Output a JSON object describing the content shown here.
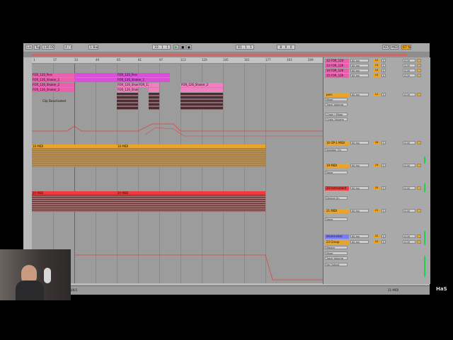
{
  "toolbar": {
    "link": "Link",
    "tap": "Tap",
    "tempo": "130.00",
    "time_sig": "4 / 4",
    "quantize": "1 Bar",
    "position": "33 . 1 . 1",
    "loop_start": "81 . 1 . 1",
    "loop_length": "8 . 0 . 0",
    "key": "KEY",
    "midi": "MIDI",
    "cpu": "67 %"
  },
  "ruler": {
    "ticks": [
      "1",
      "17",
      "33",
      "49",
      "65",
      "81",
      "97",
      "113",
      "129",
      "145",
      "161",
      "177",
      "193",
      "209"
    ]
  },
  "clips": {
    "perc": "FOR_120_Perc",
    "perc_b": "FOR_120_Perc",
    "shaker1": "FOR_126_Shaker_1",
    "shaker1b": "FOR_126_Shaker_1",
    "shaker2": "FOR_126_Shaker_2",
    "shaker2b": "FOR_126_Shaker_2",
    "shaker2c": "FOR_12",
    "shaker2d": "FOR_126_Shaker_2",
    "shaker3": "FOR_126_Shaker_3",
    "shaker3b": "FOR_126_Shaker_3",
    "deactivated": "Clip Deactivated",
    "midi_a": "16 MIDI",
    "midi_b": "16 MIDI",
    "inst_a": "20 MIDI",
    "inst_b": "20 MIDI"
  },
  "tracks": [
    {
      "name": "12 FOR_120",
      "num": "12",
      "color": "#ea5fae"
    },
    {
      "name": "13 FOR_126",
      "num": "13",
      "color": "#ea5fae"
    },
    {
      "name": "14 FOR_126",
      "num": "14",
      "color": "#ea5fae"
    },
    {
      "name": "15 FOR_126",
      "num": "15",
      "color": "#ea5fae"
    },
    {
      "name": "perc",
      "num": "11",
      "color": "#e8a52a"
    },
    {
      "name": "16 OP-1 MIDI",
      "num": "16",
      "color": "#e8a52a"
    },
    {
      "name": "19 MIDI",
      "num": "19",
      "color": "#e8a52a"
    },
    {
      "name": "20 Instrument",
      "num": "20",
      "color": "#ef3b3b"
    },
    {
      "name": "21 MIDI",
      "num": "21",
      "color": "#e8a52a"
    },
    {
      "name": "drums+bss",
      "num": "22",
      "color": "#7a7aff"
    },
    {
      "name": "23 Group",
      "num": "23",
      "color": "#e8a52a"
    }
  ],
  "mixer_io": {
    "all_ins": "All Ins",
    "no_output": "No Output",
    "master": "Master",
    "mixer": "Mixer",
    "track_volume": "Track Volume",
    "none": "None",
    "speaker_on": "Speaker On",
    "device_on": "Device On",
    "chain_mixer": "Chain | Mixer",
    "chain_volume": "Chain Volume"
  },
  "status": {
    "left": "8/8/2",
    "right": "21-MIDI"
  },
  "logo": "HaS",
  "colors": {
    "pink": "#ea5fae",
    "orange": "#e8a52a",
    "red": "#ef3b3b",
    "meter": "#1fd14b"
  }
}
